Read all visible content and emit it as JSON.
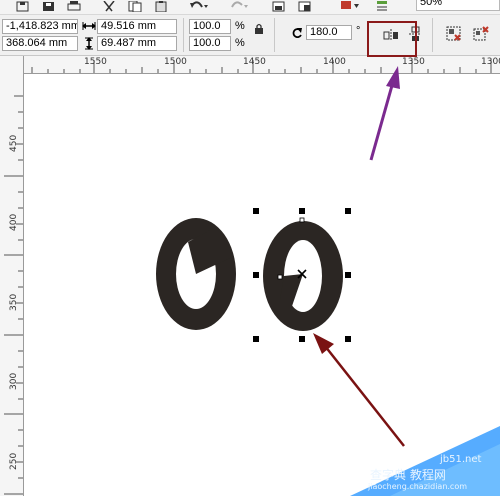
{
  "toolbar": {
    "zoom_value": "50%",
    "icons": [
      "save-icon",
      "save-all-icon",
      "print-icon",
      "cut-icon",
      "copy-icon",
      "paste-icon",
      "undo-icon",
      "redo-icon",
      "import-icon",
      "export-icon",
      "launcher-icon",
      "options-icon"
    ]
  },
  "property_bar": {
    "x_position": "-1,418.823 mm",
    "y_position": "368.064 mm",
    "width": "49.516 mm",
    "height": "69.487 mm",
    "scale_x": "100.0",
    "scale_y": "100.0",
    "percent_symbol": "%",
    "rotation_angle": "180.0",
    "degree_symbol": "°"
  },
  "horizontal_ruler": {
    "labels": [
      "1550",
      "1500",
      "1450",
      "1400",
      "1350",
      "1300"
    ]
  },
  "vertical_ruler": {
    "labels": [
      "450",
      "400",
      "350",
      "300",
      "250"
    ]
  },
  "colors": {
    "shape_fill": "#2b2623",
    "highlight_box": "#8b1a1a",
    "arrow_purple": "#7b2a8f",
    "arrow_darkred": "#7a1212",
    "watermark_blue": "#1e90ff"
  },
  "watermark": {
    "line1": "查字典 教程网",
    "line2": "jiaocheng.chazidian.com",
    "line3": "jb51.net"
  }
}
